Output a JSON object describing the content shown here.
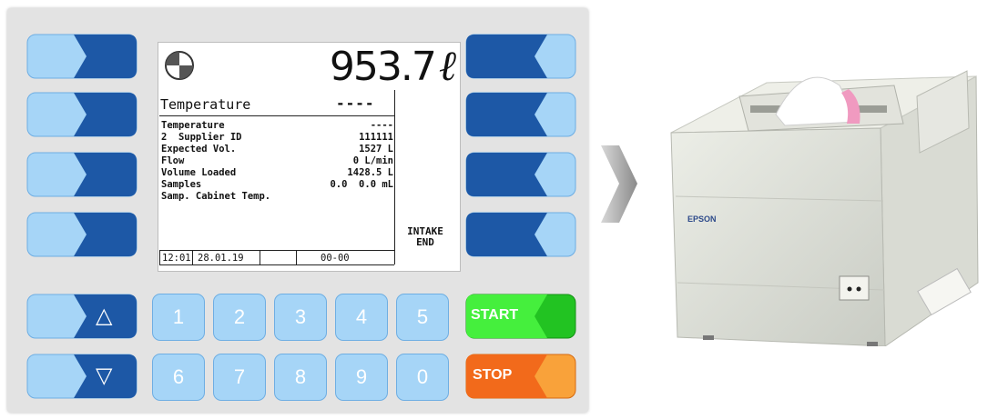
{
  "display": {
    "volume": "953.7",
    "volume_unit": "ℓ",
    "header_label": "Temperature",
    "header_value": "----",
    "rows": [
      {
        "label": "Temperature",
        "value": "----"
      },
      {
        "label": "2  Supplier ID",
        "value": "111111"
      },
      {
        "label": "Expected Vol.",
        "value": "1527 L"
      },
      {
        "label": "Flow",
        "value": "0 L/min"
      },
      {
        "label": "Volume Loaded",
        "value": "1428.5 L"
      },
      {
        "label": "Samples",
        "value": "0.0  0.0 mL"
      },
      {
        "label": "Samp. Cabinet Temp.",
        "value": ""
      }
    ],
    "softkey_label_line1": "INTAKE",
    "softkey_label_line2": "END",
    "status": {
      "time": "12:01",
      "date": "28.01.19",
      "code": "00-00"
    }
  },
  "keys": {
    "up": "△",
    "down": "▽",
    "numbers_top": [
      "1",
      "2",
      "3",
      "4",
      "5"
    ],
    "numbers_bottom": [
      "6",
      "7",
      "8",
      "9",
      "0"
    ],
    "start": "START",
    "stop": "STOP"
  },
  "printer": {
    "brand": "EPSON"
  },
  "colors": {
    "key_dark_blue": "#1d58a6",
    "key_light_blue": "#a6d5f7",
    "start_green": "#22c322",
    "stop_orange": "#f26a1b"
  }
}
